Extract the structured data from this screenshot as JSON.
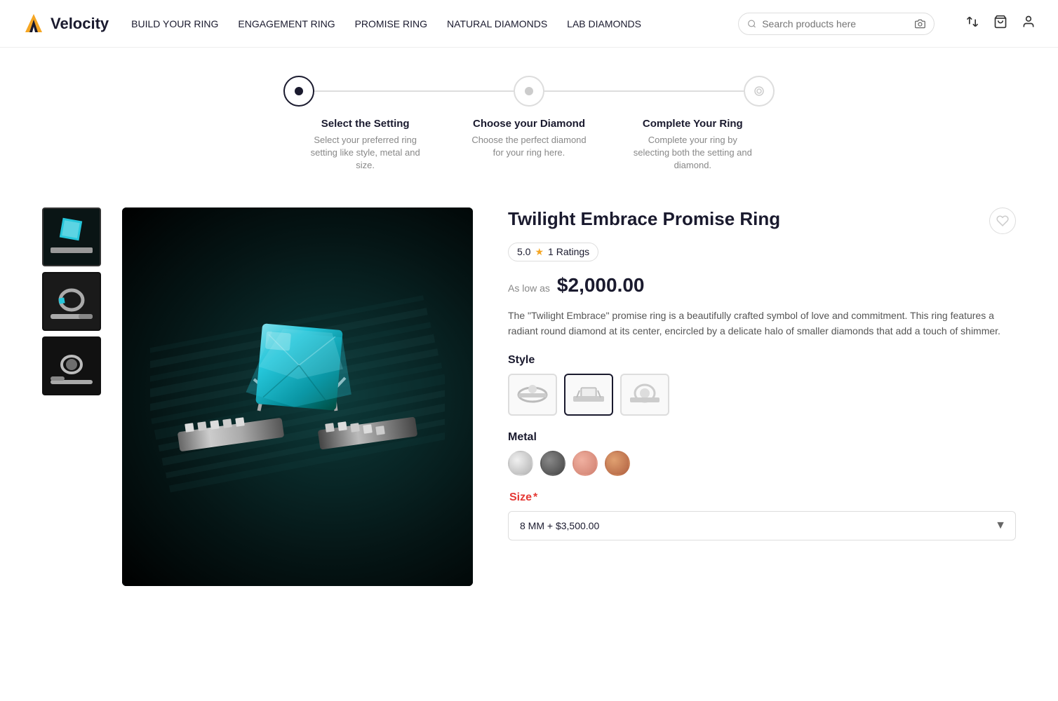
{
  "logo": {
    "text": "Velocity",
    "icon": "V"
  },
  "nav": {
    "items": [
      {
        "label": "BUILD YOUR RING",
        "id": "build-your-ring"
      },
      {
        "label": "ENGAGEMENT RING",
        "id": "engagement-ring"
      },
      {
        "label": "PROMISE RING",
        "id": "promise-ring"
      },
      {
        "label": "NATURAL DIAMONDS",
        "id": "natural-diamonds"
      },
      {
        "label": "LAB DIAMONDS",
        "id": "lab-diamonds"
      }
    ]
  },
  "search": {
    "placeholder": "Search products here"
  },
  "steps": [
    {
      "id": "select-setting",
      "title": "Select the Setting",
      "description": "Select your preferred ring setting like style, metal and size.",
      "active": true
    },
    {
      "id": "choose-diamond",
      "title": "Choose your Diamond",
      "description": "Choose the perfect diamond for your ring here.",
      "active": false
    },
    {
      "id": "complete-ring",
      "title": "Complete Your Ring",
      "description": "Complete your ring by selecting both the setting and diamond.",
      "active": false
    }
  ],
  "product": {
    "title": "Twilight Embrace Promise Ring",
    "rating": "5.0",
    "rating_count": "1 Ratings",
    "price_label": "As low as",
    "price": "$2,000.00",
    "description": "The \"Twilight Embrace\" promise ring is a beautifully crafted symbol of love and commitment. This ring features a radiant round diamond at its center, encircled by a delicate halo of smaller diamonds that add a touch of shimmer.",
    "style_label": "Style",
    "metal_label": "Metal",
    "size_label": "Size",
    "size_required": "*",
    "size_options": [
      {
        "value": "8mm",
        "label": "8 MM + $3,500.00"
      }
    ],
    "size_selected": "8 MM + $3,500.00",
    "metals": [
      {
        "id": "white-gold",
        "color": "#d4d4d4",
        "selected": false
      },
      {
        "id": "dark-silver",
        "color": "#6e6e6e",
        "selected": false
      },
      {
        "id": "rose-gold-light",
        "color": "#e8a090",
        "selected": false
      },
      {
        "id": "rose-gold",
        "color": "#d4956a",
        "selected": false
      }
    ]
  }
}
